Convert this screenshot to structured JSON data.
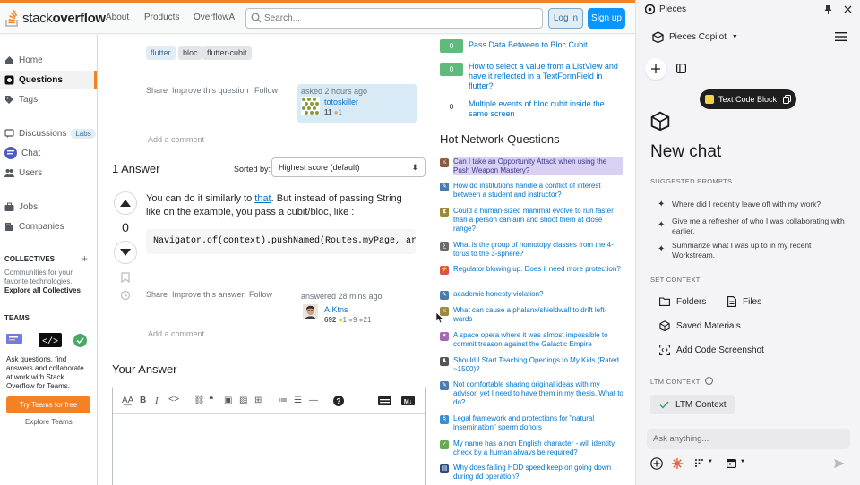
{
  "header": {
    "logo_word1": "stack",
    "logo_word2": "overflow",
    "nav": [
      "About",
      "Products",
      "OverflowAI"
    ],
    "search_placeholder": "Search...",
    "login": "Log in",
    "signup": "Sign up"
  },
  "sidebar": {
    "items": [
      {
        "label": "Home",
        "icon": "home-icon"
      },
      {
        "label": "Questions",
        "icon": "globe-icon"
      },
      {
        "label": "Tags",
        "icon": "tag-icon"
      },
      {
        "label": "Discussions",
        "icon": "discussion-icon",
        "badge": "Labs"
      },
      {
        "label": "Chat",
        "icon": "chat-icon"
      },
      {
        "label": "Users",
        "icon": "users-icon"
      },
      {
        "label": "Jobs",
        "icon": "briefcase-icon"
      },
      {
        "label": "Companies",
        "icon": "building-icon"
      }
    ],
    "collectives_heading": "COLLECTIVES",
    "collectives_text": "Communities for your favorite technologies.",
    "collectives_link": "Explore all Collectives",
    "teams_heading": "TEAMS",
    "teams_text": "Ask questions, find answers and collaborate at work with Stack Overflow for Teams.",
    "teams_button": "Try Teams for free",
    "teams_explore": "Explore Teams"
  },
  "question": {
    "tags": [
      "flutter",
      "bloc",
      "flutter-cubit"
    ],
    "actions": [
      "Share",
      "Improve this question",
      "Follow"
    ],
    "asked": "asked 2 hours ago",
    "user_name": "totoskiller",
    "user_rep": "11",
    "user_bronze": "1",
    "add_comment": "Add a comment"
  },
  "answers": {
    "title": "1 Answer",
    "sorted_by_label": "Sorted by:",
    "sort_value": "Highest score (default)",
    "vote_count": "0",
    "text_before_link": "You can do it similarly to ",
    "link_text": "that",
    "text_after_link": ". But instead of passing String like on the example, you pass a cubit/bloc, like :",
    "code": "Navigator.of(context).pushNamed(Routes.myPage, arguments",
    "actions": [
      "Share",
      "Improve this answer",
      "Follow"
    ],
    "answered": "answered 28 mins ago",
    "user_name": "A.Ktns",
    "user_rep": "692",
    "user_gold": "1",
    "user_silver": "9",
    "user_bronze": "21",
    "add_comment": "Add a comment"
  },
  "your_answer": {
    "title": "Your Answer"
  },
  "related": [
    {
      "score": "0",
      "accepted": true,
      "title": "Pass Data Between to Bloc Cubit"
    },
    {
      "score": "0",
      "accepted": true,
      "title": "How to select a value from a ListView and have it reflected in a TextFormField in flutter?"
    },
    {
      "score": "0",
      "accepted": false,
      "title": "Multiple events of bloc cubit inside the same screen"
    }
  ],
  "hot_network": {
    "title": "Hot Network Questions",
    "items": [
      {
        "title": "Can I take an Opportunity Attack when using the Push Weapon Mastery?",
        "color": "#8c5a3c",
        "highlight": true
      },
      {
        "title": "How do institutions handle a conflict of interest between a student and instructor?",
        "color": "#4a7ab0",
        "highlight": false
      },
      {
        "title": "Could a human-sized mammal evolve to run faster than a person can aim and shoot them at close range?",
        "color": "#9b8a3e",
        "highlight": false
      },
      {
        "title": "What is the group of homotopy classes from the 4-torus to the 3-sphere?",
        "color": "#6a6a6a",
        "highlight": false
      },
      {
        "title": "Regulator blowing up. Does it need more protection?",
        "color": "#d9534f",
        "highlight": false
      },
      {
        "title": "academic honesty violation?",
        "color": "#4a7ab0",
        "highlight": false
      },
      {
        "title": "What can cause a phalanx/shieldwall to drift left-wards",
        "color": "#9b8a3e",
        "highlight": false
      },
      {
        "title": "A space opera where it was almost impossible to commit treason against the Galactic Empire",
        "color": "#a26ab3",
        "highlight": false
      },
      {
        "title": "Should I Start Teaching Openings to My Kids (Rated ~1500)?",
        "color": "#555555",
        "highlight": false
      },
      {
        "title": "Not comfortable sharing original ideas with my advisor, yet I need to have them in my thesis. What to do?",
        "color": "#4a7ab0",
        "highlight": false
      },
      {
        "title": "Legal framework and protections for \"natural insemination\" sperm donors",
        "color": "#3a8fd4",
        "highlight": false
      },
      {
        "title": "My name has a non English character - will identity check by a human always be required?",
        "color": "#6aa84f",
        "highlight": false
      },
      {
        "title": "Why does failing HDD speed keep on going down during dd operation?",
        "color": "#2b4c7e",
        "highlight": false
      }
    ]
  },
  "pieces": {
    "window_title": "Pieces",
    "copilot_label": "Pieces Copilot",
    "pill_label": "Text Code Block",
    "new_chat": "New chat",
    "suggested_heading": "SUGGESTED PROMPTS",
    "prompts": [
      "Where did I recently leave off with my work?",
      "Give me a refresher of who I was collaborating with earlier.",
      "Summarize what I was up to in my recent Workstream."
    ],
    "set_context_heading": "SET CONTEXT",
    "context_folders": "Folders",
    "context_files": "Files",
    "context_saved": "Saved Materials",
    "context_screenshot": "Add Code Screenshot",
    "ltm_heading": "LTM CONTEXT",
    "ltm_label": "LTM Context",
    "input_placeholder": "Ask anything..."
  },
  "colors": {
    "so_orange": "#f48225",
    "so_blue": "#0a95ff",
    "link_blue": "#0074cc",
    "accepted_green": "#5eba7d"
  }
}
